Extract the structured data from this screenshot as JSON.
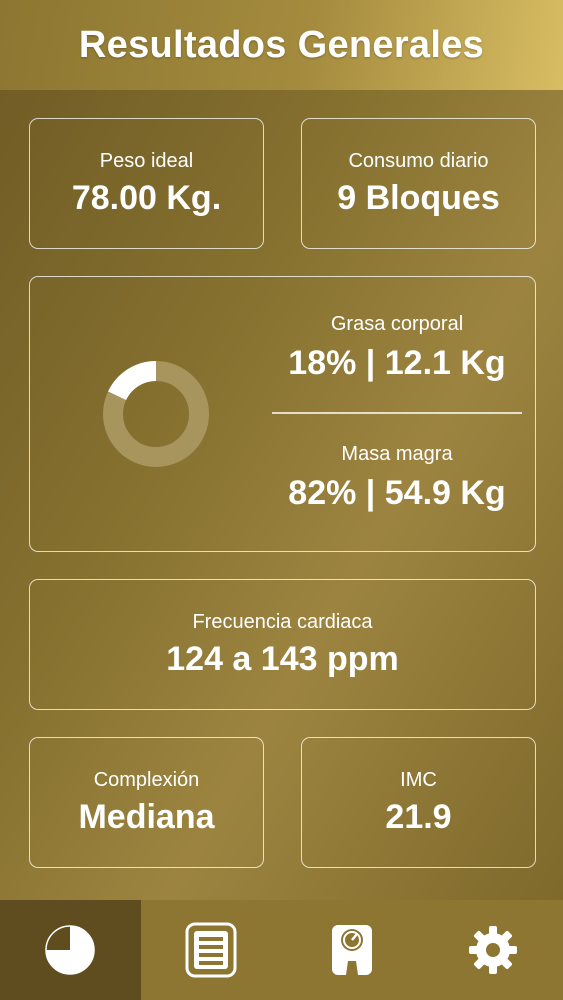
{
  "header": {
    "title": "Resultados Generales"
  },
  "cards": {
    "ideal_weight": {
      "label": "Peso ideal",
      "value": "78.00 Kg."
    },
    "daily_intake": {
      "label": "Consumo diario",
      "value": "9 Bloques"
    },
    "composition": {
      "body_fat": {
        "label": "Grasa corporal",
        "value": "18% | 12.1 Kg",
        "fraction": 0.18
      },
      "lean_mass": {
        "label": "Masa magra",
        "value": "82% | 54.9 Kg",
        "fraction": 0.82
      }
    },
    "heart_rate": {
      "label": "Frecuencia cardiaca",
      "value": "124 a 143 ppm"
    },
    "build": {
      "label": "Complexión",
      "value": "Mediana"
    },
    "bmi": {
      "label": "IMC",
      "value": "21.9"
    }
  },
  "nav": {
    "items": [
      {
        "icon": "pie-chart-icon",
        "active": true
      },
      {
        "icon": "list-document-icon",
        "active": false
      },
      {
        "icon": "scale-icon",
        "active": false
      },
      {
        "icon": "gear-icon",
        "active": false
      }
    ]
  },
  "colors": {
    "accent_gold": "#d8bd63",
    "donut_track": "#a8955e",
    "donut_fill": "#ffffff"
  }
}
